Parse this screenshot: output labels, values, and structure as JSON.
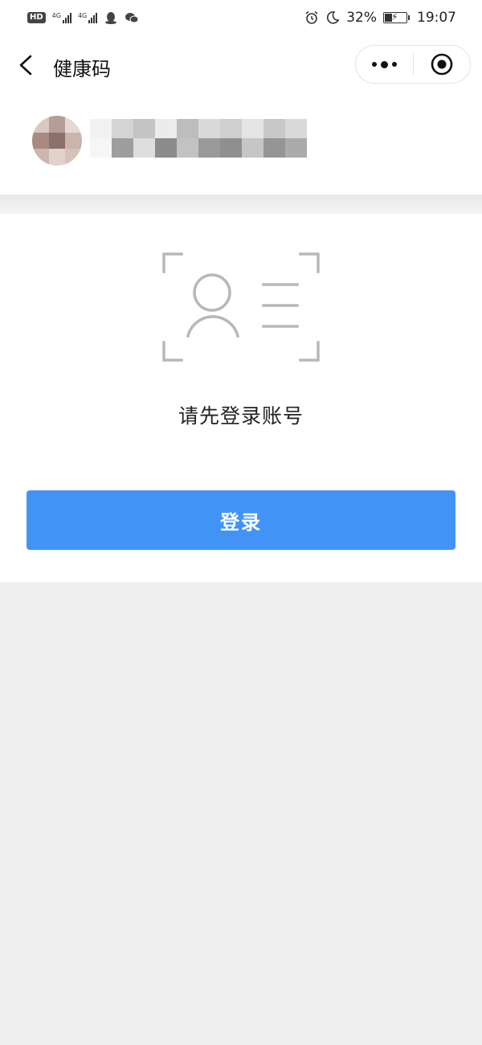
{
  "status_bar": {
    "hd_badge": "HD",
    "net1": "4G",
    "net2": "4G",
    "battery_text": "32%",
    "battery_level": 0.32,
    "time": "19:07",
    "icons": [
      "qq-icon",
      "wechat-icon",
      "alarm-icon",
      "moon-icon",
      "battery-icon"
    ]
  },
  "nav": {
    "title": "健康码",
    "back_icon": "chevron-left-icon",
    "more_icon": "more-dots-icon",
    "close_icon": "target-close-icon"
  },
  "profile": {
    "avatar": "blurred-avatar",
    "name": "blurred-name"
  },
  "main": {
    "illustration": "id-card-person-icon",
    "prompt": "请先登录账号",
    "login_button": "登录"
  },
  "colors": {
    "accent": "#4293f6",
    "background": "#efefef",
    "card": "#ffffff",
    "illustration_stroke": "#b8b8b8"
  }
}
